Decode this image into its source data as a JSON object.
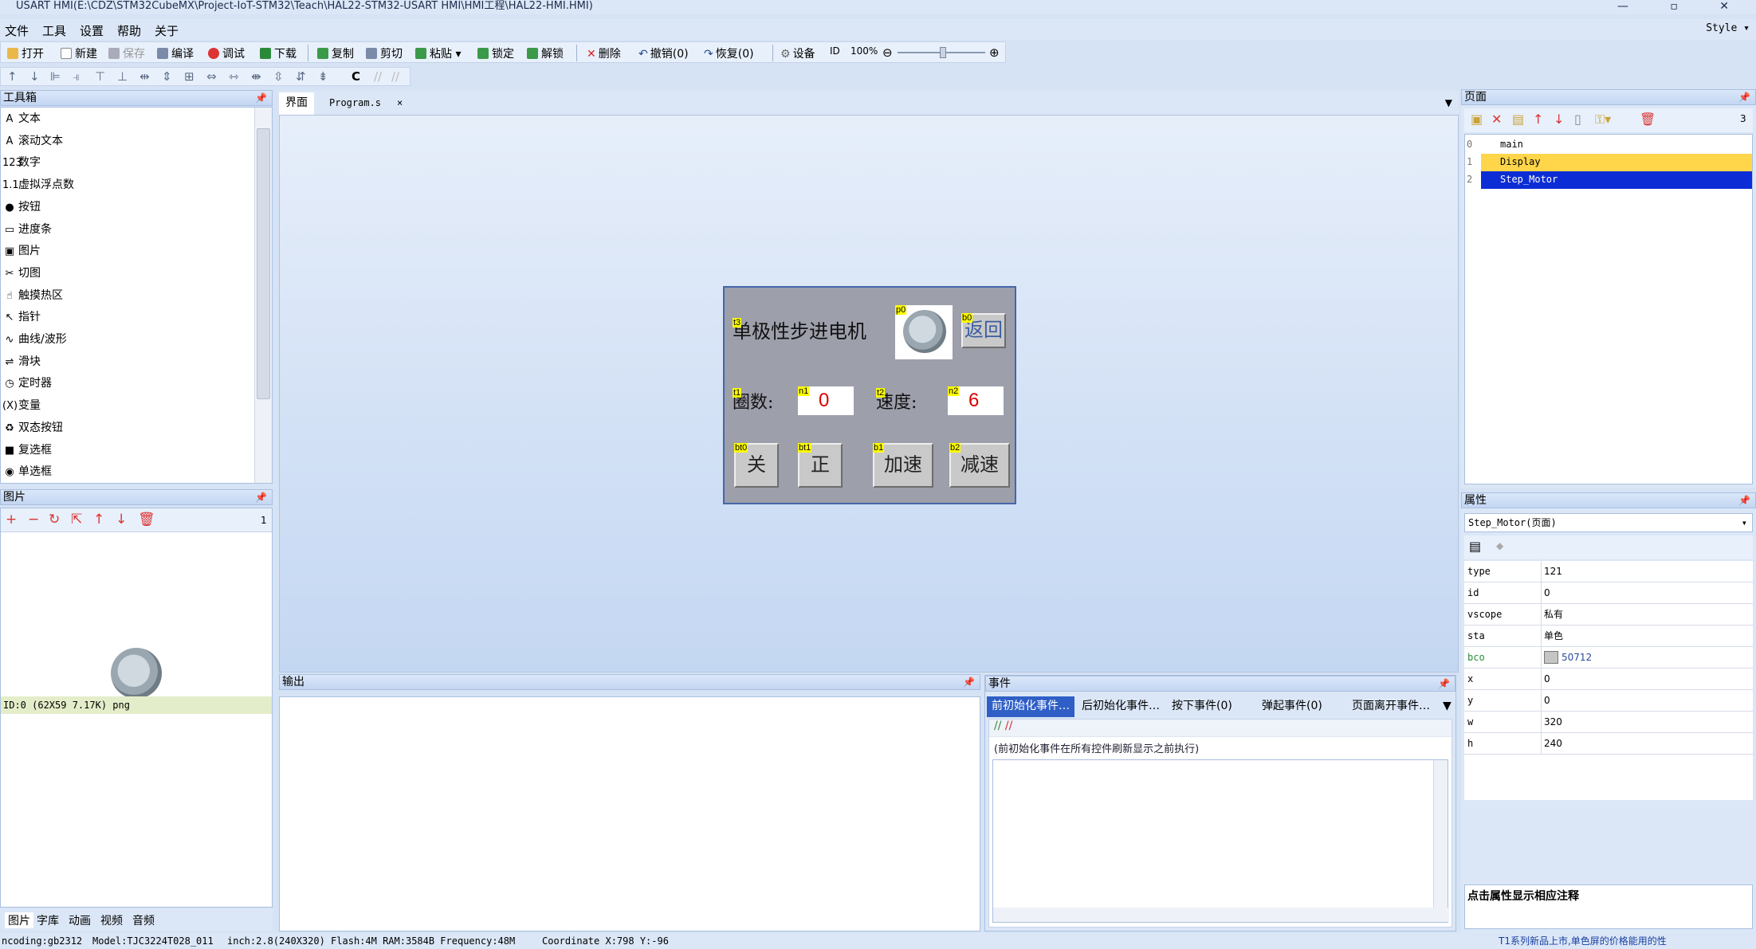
{
  "window": {
    "title": "USART HMI(E:\\CDZ\\STM32CubeMX\\Project-IoT-STM32\\Teach\\HAL22-STM32-USART HMI\\HMI工程\\HAL22-HMI.HMI)",
    "controls": "—  ▫  ✕"
  },
  "menu": {
    "items": [
      "文件",
      "工具",
      "设置",
      "帮助",
      "关于"
    ],
    "style": "Style ▾"
  },
  "toolbar": {
    "open": "打开",
    "new": "新建",
    "save": "保存",
    "compile": "编译",
    "debug": "调试",
    "download": "下载",
    "copy": "复制",
    "cut": "剪切",
    "paste": "粘贴",
    "lock": "锁定",
    "unlock": "解锁",
    "delete": "删除",
    "undo": "撤销(0)",
    "redo": "恢复(0)",
    "device": "设备",
    "id": "ID",
    "zoom": "100%"
  },
  "toolbox": {
    "title": "工具箱",
    "items": [
      "文本",
      "滚动文本",
      "数字",
      "虚拟浮点数",
      "按钮",
      "进度条",
      "图片",
      "切图",
      "触摸热区",
      "指针",
      "曲线/波形",
      "滑块",
      "定时器",
      "变量",
      "双态按钮",
      "复选框",
      "单选框"
    ],
    "icons": [
      "A",
      "A",
      "123",
      "1.1",
      "●",
      "▭",
      "▣",
      "✂",
      "☝",
      "↖",
      "∿",
      "⇌",
      "◷",
      "(X)",
      "♻",
      "■",
      "◉"
    ]
  },
  "imagepanel": {
    "title": "图片",
    "count": "1",
    "caption": "ID:0  (62X59 7.17K) png"
  },
  "bottom_tabs": [
    "图片",
    "字库",
    "动画",
    "视频",
    "音频"
  ],
  "doc_tabs": {
    "design": "界面",
    "program": "Program.s",
    "close": "×"
  },
  "hmi": {
    "title": "单极性步进电机",
    "tag_t3": "t3",
    "tag_p0": "p0",
    "tag_b0": "b0",
    "back": "返回",
    "tag_t1": "t1",
    "label_turns": "圈数:",
    "tag_n1": "n1",
    "turns_value": "0",
    "tag_t2": "t2",
    "label_speed": "速度:",
    "tag_n2": "n2",
    "speed_value": "6",
    "tag_bt0": "bt0",
    "btn_off": "关",
    "tag_bt1": "bt1",
    "btn_fwd": "正",
    "tag_b1": "b1",
    "btn_accel": "加速",
    "tag_b2": "b2",
    "btn_decel": "减速"
  },
  "output": {
    "title": "输出"
  },
  "events": {
    "title": "事件",
    "tabs": [
      "前初始化事件…",
      "后初始化事件…",
      "按下事件(0)",
      "弹起事件(0)",
      "页面离开事件…"
    ],
    "hint": "(前初始化事件在所有控件刷新显示之前执行)"
  },
  "pages": {
    "title": "页面",
    "count": "3",
    "list": [
      {
        "idx": "0",
        "name": "main"
      },
      {
        "idx": "1",
        "name": "Display"
      },
      {
        "idx": "2",
        "name": "Step_Motor"
      }
    ]
  },
  "properties": {
    "title": "属性",
    "selected": "Step_Motor(页面)",
    "rows": [
      {
        "k": "type",
        "v": "121"
      },
      {
        "k": "id",
        "v": "0"
      },
      {
        "k": "vscope",
        "v": "私有"
      },
      {
        "k": "sta",
        "v": "单色"
      },
      {
        "k": "bco",
        "v": "50712"
      },
      {
        "k": "x",
        "v": "0"
      },
      {
        "k": "y",
        "v": "0"
      },
      {
        "k": "w",
        "v": "320"
      },
      {
        "k": "h",
        "v": "240"
      }
    ],
    "note": "点击属性显示相应注释"
  },
  "status": {
    "encoding": "ncoding:gb2312",
    "model": "Model:TJC3224T028_011",
    "info": "inch:2.8(240X320) Flash:4M RAM:3584B Frequency:48M",
    "coord": "Coordinate X:798  Y:-96",
    "ad": "T1系列新品上市,单色屏的价格能用的性"
  },
  "colors": {
    "accent": "#0c2dd6",
    "selected_page": "#ffd54a",
    "tag": "#ffff00",
    "hmi_bg": "#9d9fab"
  }
}
